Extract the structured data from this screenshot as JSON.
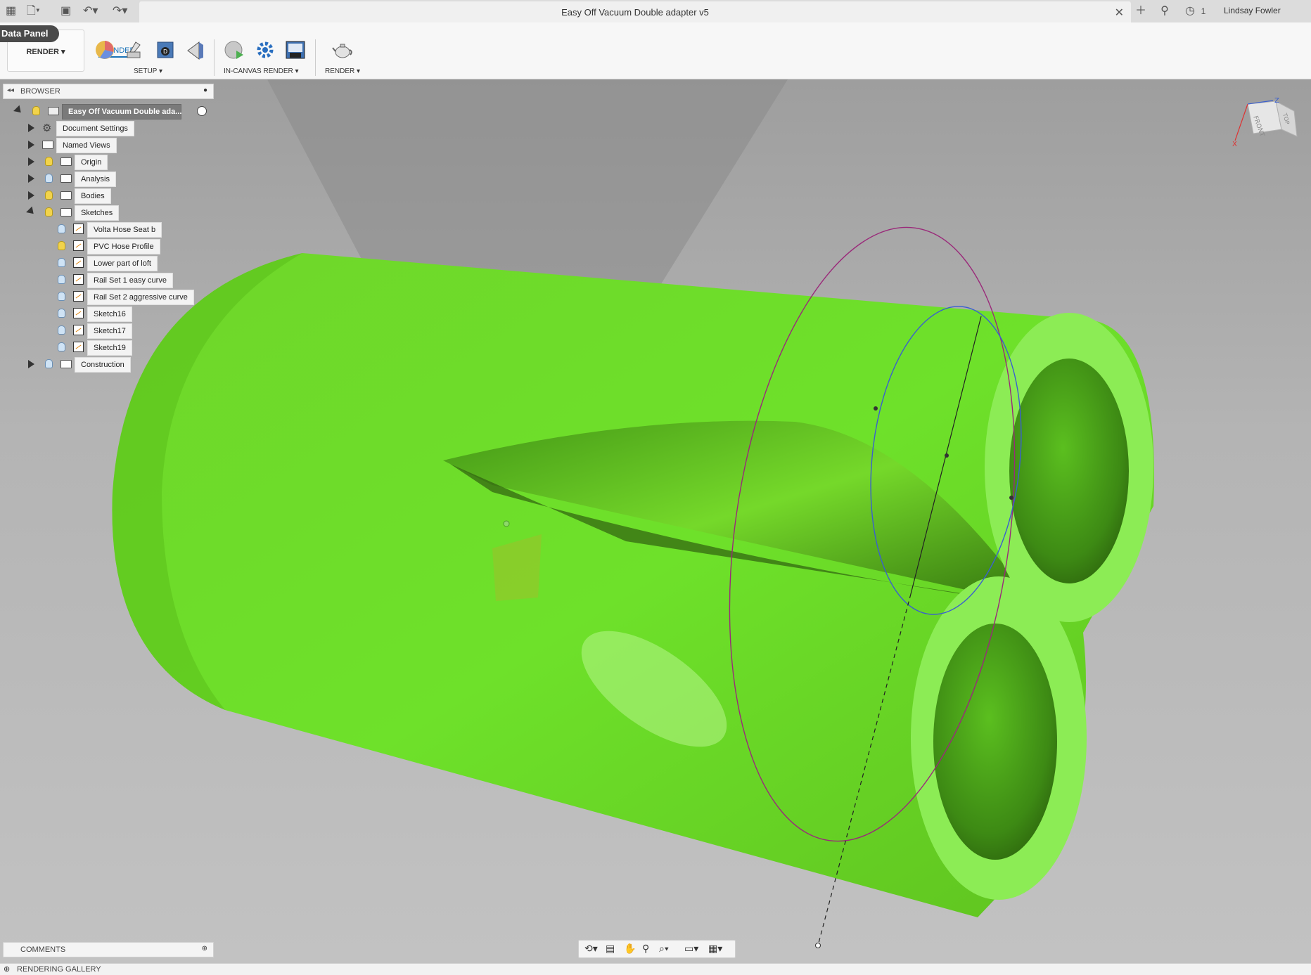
{
  "title_bar": {
    "document_title": "Easy Off Vacuum Double adapter v5",
    "job_count": "1",
    "user_name": "Lindsay Fowler",
    "icons": [
      "app-grid-icon",
      "file-icon",
      "save-icon",
      "undo-icon",
      "redo-icon",
      "new-tab-icon",
      "extensions-icon",
      "job-status-icon"
    ]
  },
  "ribbon": {
    "data_panel_label": "Data Panel",
    "workspace_label": "RENDER",
    "active_tab": "RENDER",
    "groups": [
      {
        "label": "SETUP",
        "tools": [
          "appearance-icon",
          "scene-settings-icon",
          "texture-map-icon",
          "decal-icon"
        ]
      },
      {
        "label": "IN-CANVAS RENDER",
        "tools": [
          "in-canvas-render-icon",
          "render-settings-icon",
          "capture-image-icon"
        ]
      },
      {
        "label": "RENDER",
        "tools": [
          "render-teapot-icon"
        ]
      }
    ]
  },
  "browser": {
    "header_label": "BROWSER",
    "root_label": "Easy Off Vacuum Double ada...",
    "items": [
      {
        "label": "Document Settings",
        "icon": "gear-icon"
      },
      {
        "label": "Named Views",
        "icon": "folder-icon"
      },
      {
        "label": "Origin",
        "icon": "folder-icon"
      },
      {
        "label": "Analysis",
        "icon": "folder-icon"
      },
      {
        "label": "Bodies",
        "icon": "folder-icon"
      },
      {
        "label": "Sketches",
        "icon": "folder-icon"
      },
      {
        "label": "Construction",
        "icon": "folder-icon"
      }
    ],
    "sketches": [
      {
        "label": "Volta Hose Seat b"
      },
      {
        "label": "PVC Hose Profile"
      },
      {
        "label": "Lower part of loft"
      },
      {
        "label": "Rail Set 1 easy curve"
      },
      {
        "label": "Rail Set 2 aggressive curve"
      },
      {
        "label": "Sketch16"
      },
      {
        "label": "Sketch17"
      },
      {
        "label": "Sketch19"
      }
    ]
  },
  "viewcube": {
    "face_front": "FRONT",
    "face_top": "TOP",
    "axis_x": "X",
    "axis_z": "Z"
  },
  "comments_label": "COMMENTS",
  "status_label": "RENDERING GALLERY",
  "colors": {
    "model_green": "#6fe028",
    "accent_blue": "#1a73b8",
    "sketch_magenta": "#9a2a7a",
    "sketch_blue": "#3a5fcf"
  }
}
